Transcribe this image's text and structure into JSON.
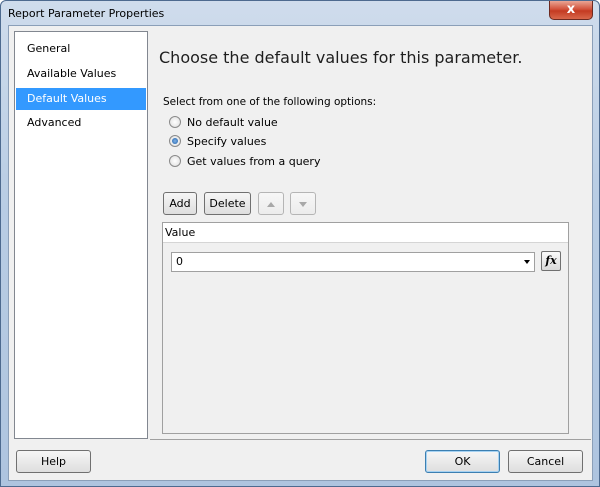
{
  "window": {
    "title": "Report Parameter Properties",
    "close_label": "x"
  },
  "nav": {
    "items": [
      {
        "label": "General",
        "selected": false
      },
      {
        "label": "Available Values",
        "selected": false
      },
      {
        "label": "Default Values",
        "selected": true
      },
      {
        "label": "Advanced",
        "selected": false
      }
    ]
  },
  "main": {
    "heading": "Choose the default values for this parameter.",
    "options_label": "Select from one of the following options:",
    "options": [
      {
        "label": "No default value",
        "checked": false
      },
      {
        "label": "Specify values",
        "checked": true
      },
      {
        "label": "Get values from a query",
        "checked": false
      }
    ],
    "toolbar": {
      "add_label": "Add",
      "delete_label": "Delete",
      "move_up_icon": "arrow-up-icon",
      "move_down_icon": "arrow-down-icon"
    },
    "grid": {
      "column_header": "Value",
      "rows": [
        {
          "value": "0"
        }
      ],
      "expression_label": "fx"
    }
  },
  "footer": {
    "help_label": "Help",
    "ok_label": "OK",
    "cancel_label": "Cancel"
  },
  "colors": {
    "selection": "#3399ff",
    "window_frame": "#b9cde4",
    "close_button": "#c43b22"
  }
}
